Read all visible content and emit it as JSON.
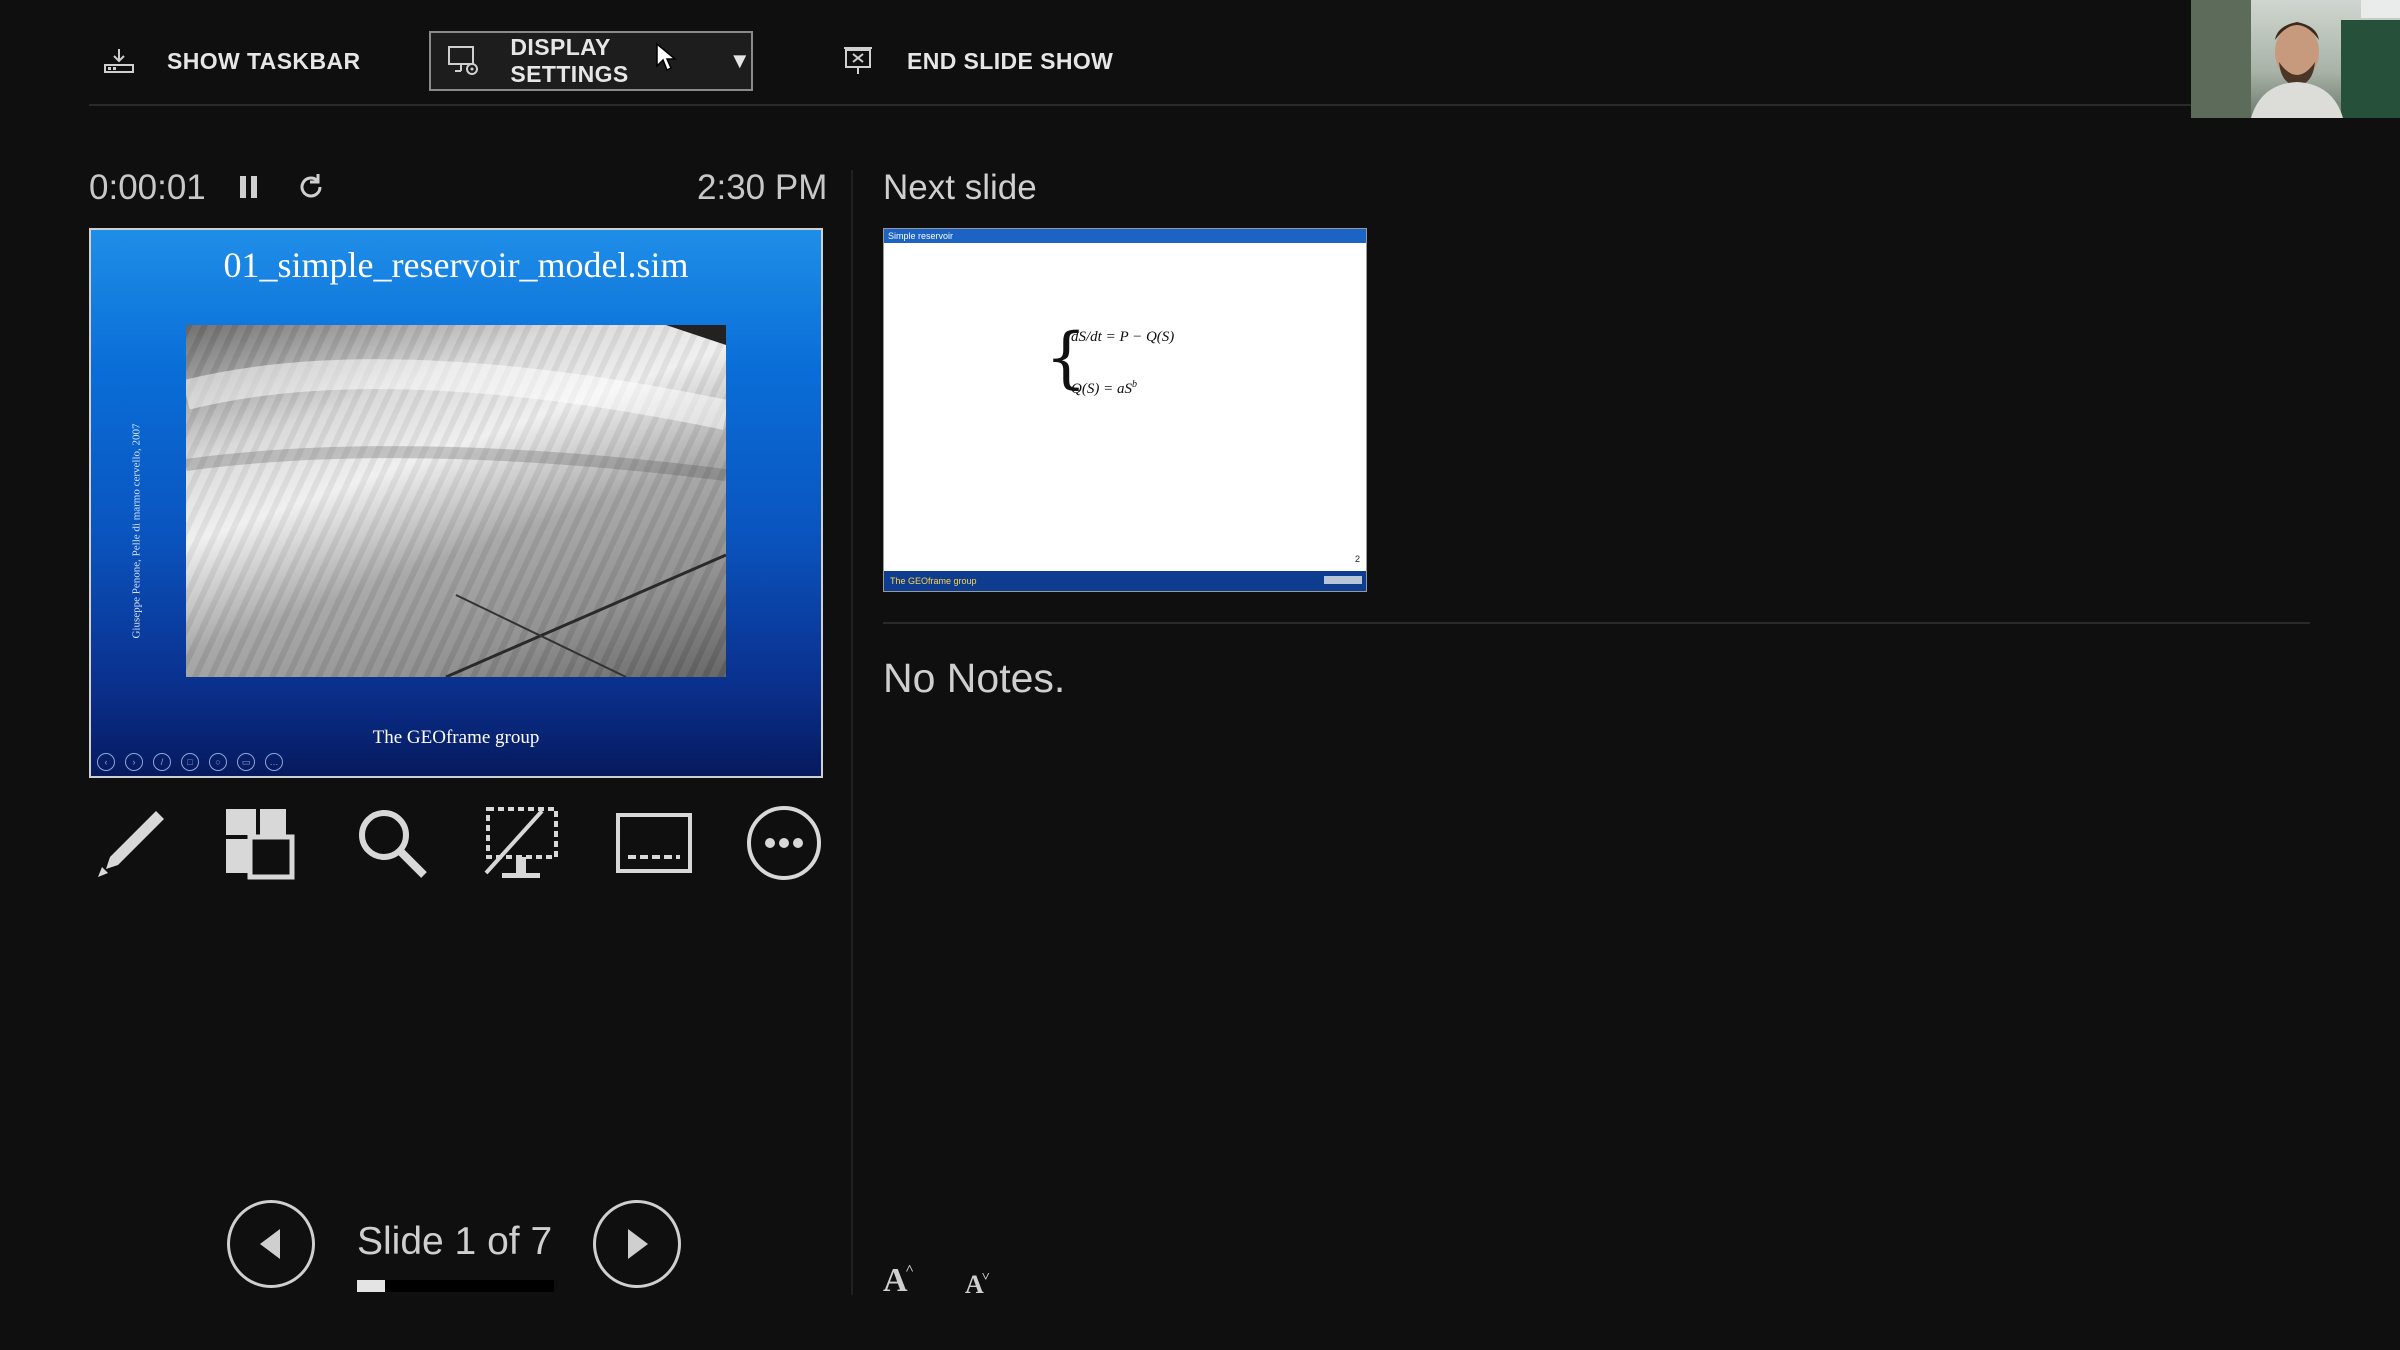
{
  "toolbar": {
    "show_taskbar": "SHOW TASKBAR",
    "display_settings": "DISPLAY SETTINGS",
    "end_slide_show": "END SLIDE SHOW"
  },
  "timer": {
    "elapsed": "0:00:01",
    "clock": "2:30 PM"
  },
  "current_slide": {
    "title": "01_simple_reservoir_model.sim",
    "side_caption": "Giuseppe Penone, Pelle di marmo cervello, 2007",
    "footer": "The GEOframe group"
  },
  "tools": [
    "pen-tool",
    "see-all-slides",
    "zoom",
    "black-screen",
    "subtitles",
    "more-options"
  ],
  "navigation": {
    "counter": "Slide 1 of 7",
    "current": 1,
    "total": 7,
    "progress": 0.14
  },
  "next_slide": {
    "label": "Next slide",
    "header": "Simple reservoir",
    "eq1_lhs": "dS/dt = P − Q(S)",
    "eq2": "Q(S) = aS",
    "eq2_exp": "b",
    "page_num": "2",
    "footer": "The GEOframe group"
  },
  "notes": {
    "text": "No Notes."
  },
  "font_controls": {
    "increase": "A",
    "decrease": "A"
  }
}
